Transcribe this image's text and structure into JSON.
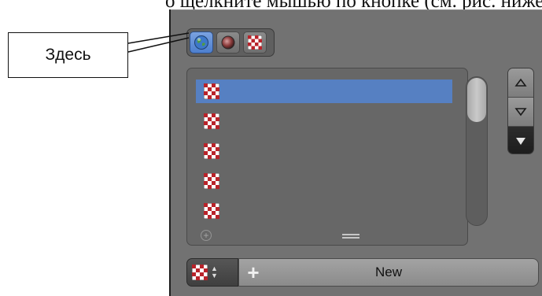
{
  "document": {
    "partial_text": "о щелкните мышью по кнопке (см. рис. ниже)."
  },
  "callout": {
    "label": "Здесь"
  },
  "context_tabs": [
    {
      "icon": "world-icon",
      "active": true
    },
    {
      "icon": "material-sphere-icon",
      "active": false
    },
    {
      "icon": "texture-checker-icon",
      "active": false
    }
  ],
  "texture_slots": [
    {
      "icon": "texture-checker-icon",
      "selected": true
    },
    {
      "icon": "texture-checker-icon",
      "selected": false
    },
    {
      "icon": "texture-checker-icon",
      "selected": false
    },
    {
      "icon": "texture-checker-icon",
      "selected": false
    },
    {
      "icon": "texture-checker-icon",
      "selected": false
    }
  ],
  "side_buttons": [
    {
      "icon": "move-up-icon"
    },
    {
      "icon": "move-down-icon"
    },
    {
      "icon": "specials-menu-icon"
    }
  ],
  "bottom_bar": {
    "selector_icon": "texture-checker-icon",
    "new_label": "New"
  },
  "colors": {
    "panel_bg": "#727272",
    "selection": "#5680c2",
    "active_tab": "#5b8ad6",
    "checker_red": "#b8232a"
  }
}
